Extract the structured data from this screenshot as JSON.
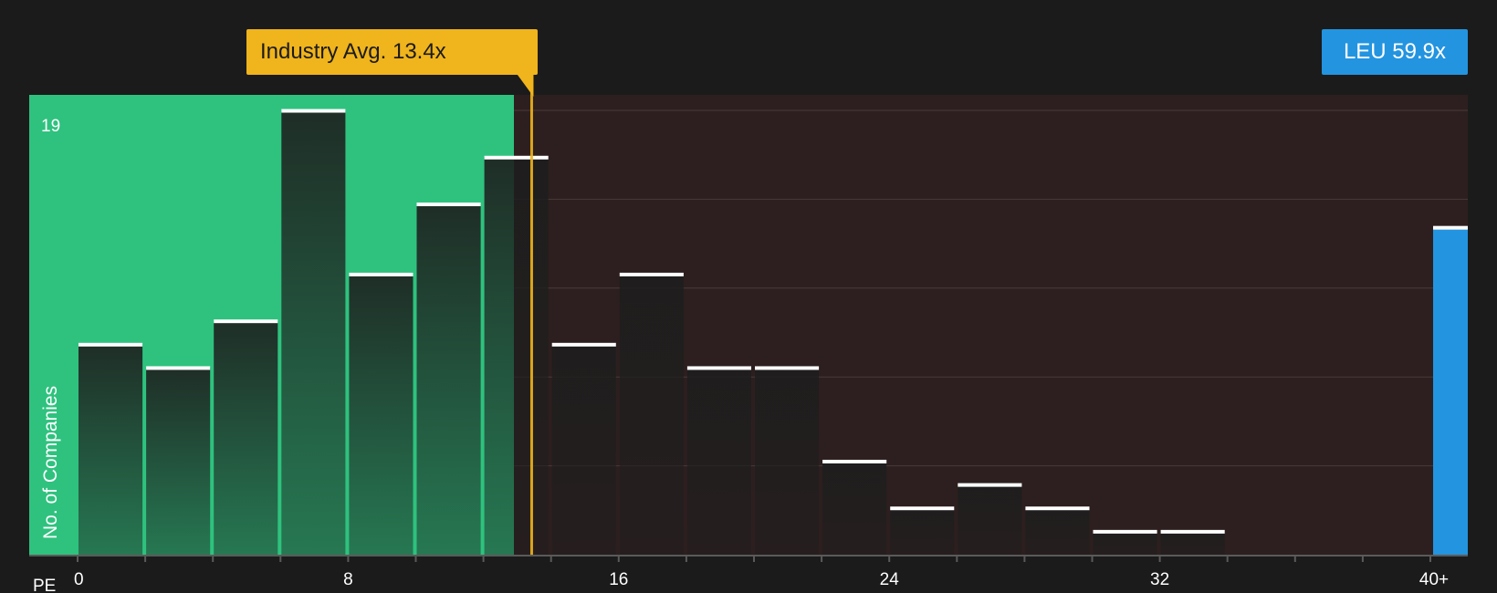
{
  "chart_data": {
    "type": "bar",
    "xlabel": "PE",
    "ylabel": "No. of Companies",
    "x_ticks": [
      "0",
      "8",
      "16",
      "24",
      "32",
      "40+"
    ],
    "y_max_label": "19",
    "ylim": [
      0,
      19
    ],
    "bin_width": 2,
    "bins": [
      {
        "start": 0,
        "value": 9
      },
      {
        "start": 2,
        "value": 8
      },
      {
        "start": 4,
        "value": 10
      },
      {
        "start": 6,
        "value": 19
      },
      {
        "start": 8,
        "value": 12
      },
      {
        "start": 10,
        "value": 15
      },
      {
        "start": 12,
        "value": 17
      },
      {
        "start": 14,
        "value": 9
      },
      {
        "start": 16,
        "value": 12
      },
      {
        "start": 18,
        "value": 8
      },
      {
        "start": 20,
        "value": 8
      },
      {
        "start": 22,
        "value": 4
      },
      {
        "start": 24,
        "value": 2
      },
      {
        "start": 26,
        "value": 3
      },
      {
        "start": 28,
        "value": 2
      },
      {
        "start": 30,
        "value": 1
      },
      {
        "start": 32,
        "value": 1
      },
      {
        "start": 34,
        "value": 0
      },
      {
        "start": 36,
        "value": 0
      },
      {
        "start": 38,
        "value": 0
      },
      {
        "start": 40,
        "value": 14
      }
    ],
    "industry_avg": {
      "value": 13.4,
      "label": "Industry Avg. 13.4x"
    },
    "company": {
      "value": 59.9,
      "label": "LEU 59.9x"
    },
    "colors": {
      "background": "#1b1b1b",
      "below_avg_region": "#2ec27e",
      "above_avg_region": "#2d1f1f",
      "industry_callout": "#f0b41c",
      "company_bar": "#2394e0",
      "bar_cap": "#ffffff"
    }
  }
}
